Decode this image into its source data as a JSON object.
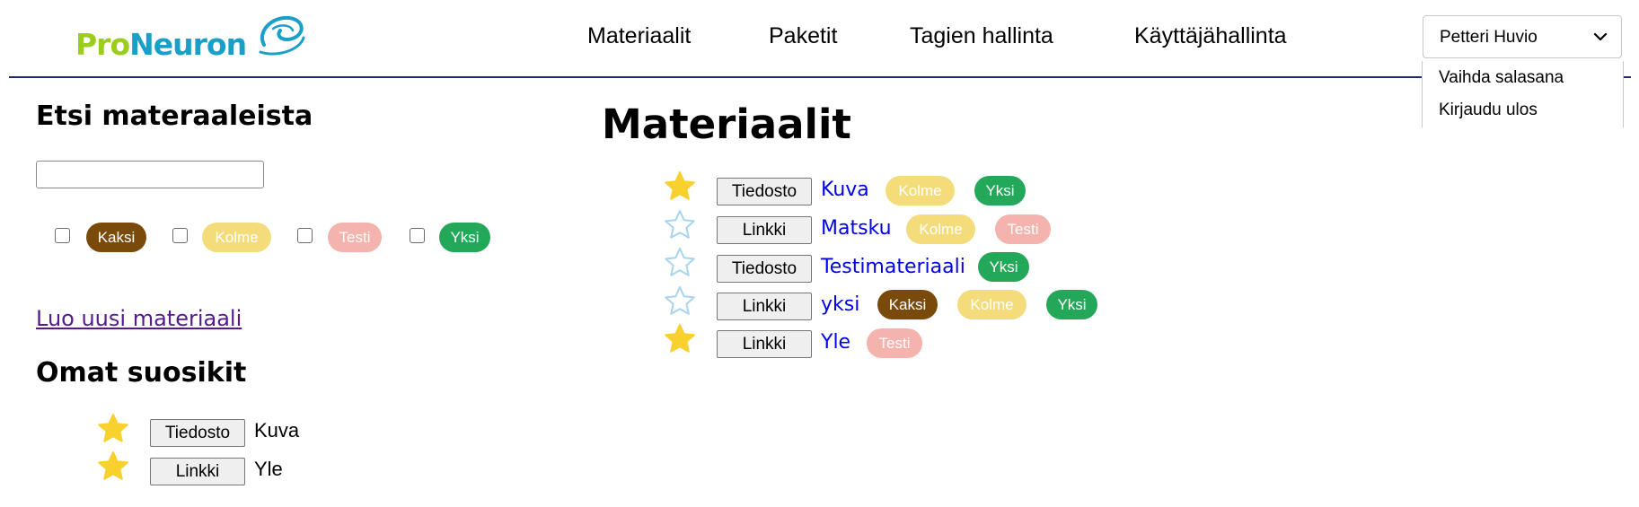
{
  "header": {
    "logo": {
      "part1": "Pro",
      "part2": "Neuron",
      "icon": "swirl-logo-icon"
    },
    "nav": [
      "Materiaalit",
      "Paketit",
      "Tagien hallinta",
      "Käyttäjähallinta"
    ],
    "user_select": {
      "value": "Petteri Huvio",
      "icon": "chevron-down-icon"
    },
    "user_menu": [
      "Vaihda salasana",
      "Kirjaudu ulos"
    ]
  },
  "sidebar": {
    "search_title": "Etsi materaaleista",
    "search_value": "",
    "filter_tags": [
      {
        "label": "Kaksi",
        "checked": false
      },
      {
        "label": "Kolme",
        "checked": false
      },
      {
        "label": "Testi",
        "checked": false
      },
      {
        "label": "Yksi",
        "checked": false
      }
    ],
    "new_material_link": "Luo uusi materiaali",
    "favorites_title": "Omat suosikit",
    "favorites": [
      {
        "type": "Tiedosto",
        "name": "Kuva",
        "starred": true
      },
      {
        "type": "Linkki",
        "name": "Yle",
        "starred": true
      }
    ]
  },
  "main": {
    "title": "Materiaalit",
    "materials": [
      {
        "type": "Tiedosto",
        "name": "Kuva",
        "starred": true,
        "tags": [
          "Kolme",
          "Yksi"
        ]
      },
      {
        "type": "Linkki",
        "name": "Matsku",
        "starred": false,
        "tags": [
          "Kolme",
          "Testi"
        ]
      },
      {
        "type": "Tiedosto",
        "name": "Testimateriaali",
        "starred": false,
        "tags": [
          "Yksi"
        ]
      },
      {
        "type": "Linkki",
        "name": "yksi",
        "starred": false,
        "tags": [
          "Kaksi",
          "Kolme",
          "Yksi"
        ]
      },
      {
        "type": "Linkki",
        "name": "Yle",
        "starred": true,
        "tags": [
          "Testi"
        ]
      }
    ]
  },
  "colors": {
    "tag_kaksi": "#7a4a0a",
    "tag_kolme": "#f5dc7a",
    "tag_testi": "#f4b3ad",
    "tag_yksi": "#23a85a",
    "star_filled": "#f8d12f",
    "star_outline": "#a8d4ee",
    "link": "#0000ee",
    "visited_link": "#551a8b",
    "header_line": "#1f2a6e",
    "logo_green": "#9ccc1e",
    "logo_blue": "#1aa0c8"
  }
}
